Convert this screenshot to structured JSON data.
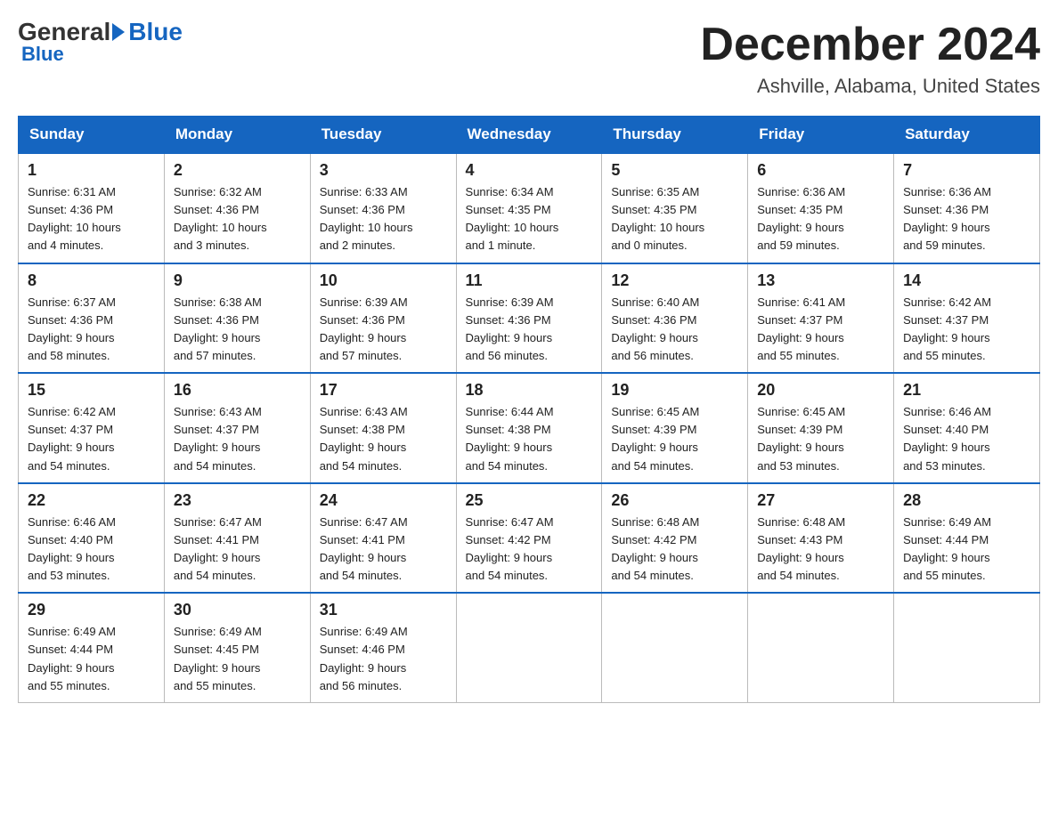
{
  "header": {
    "logo_general": "General",
    "logo_blue": "Blue",
    "month_title": "December 2024",
    "location": "Ashville, Alabama, United States"
  },
  "weekdays": [
    "Sunday",
    "Monday",
    "Tuesday",
    "Wednesday",
    "Thursday",
    "Friday",
    "Saturday"
  ],
  "weeks": [
    [
      {
        "day": "1",
        "sunrise": "Sunrise: 6:31 AM",
        "sunset": "Sunset: 4:36 PM",
        "daylight": "Daylight: 10 hours",
        "daylight2": "and 4 minutes."
      },
      {
        "day": "2",
        "sunrise": "Sunrise: 6:32 AM",
        "sunset": "Sunset: 4:36 PM",
        "daylight": "Daylight: 10 hours",
        "daylight2": "and 3 minutes."
      },
      {
        "day": "3",
        "sunrise": "Sunrise: 6:33 AM",
        "sunset": "Sunset: 4:36 PM",
        "daylight": "Daylight: 10 hours",
        "daylight2": "and 2 minutes."
      },
      {
        "day": "4",
        "sunrise": "Sunrise: 6:34 AM",
        "sunset": "Sunset: 4:35 PM",
        "daylight": "Daylight: 10 hours",
        "daylight2": "and 1 minute."
      },
      {
        "day": "5",
        "sunrise": "Sunrise: 6:35 AM",
        "sunset": "Sunset: 4:35 PM",
        "daylight": "Daylight: 10 hours",
        "daylight2": "and 0 minutes."
      },
      {
        "day": "6",
        "sunrise": "Sunrise: 6:36 AM",
        "sunset": "Sunset: 4:35 PM",
        "daylight": "Daylight: 9 hours",
        "daylight2": "and 59 minutes."
      },
      {
        "day": "7",
        "sunrise": "Sunrise: 6:36 AM",
        "sunset": "Sunset: 4:36 PM",
        "daylight": "Daylight: 9 hours",
        "daylight2": "and 59 minutes."
      }
    ],
    [
      {
        "day": "8",
        "sunrise": "Sunrise: 6:37 AM",
        "sunset": "Sunset: 4:36 PM",
        "daylight": "Daylight: 9 hours",
        "daylight2": "and 58 minutes."
      },
      {
        "day": "9",
        "sunrise": "Sunrise: 6:38 AM",
        "sunset": "Sunset: 4:36 PM",
        "daylight": "Daylight: 9 hours",
        "daylight2": "and 57 minutes."
      },
      {
        "day": "10",
        "sunrise": "Sunrise: 6:39 AM",
        "sunset": "Sunset: 4:36 PM",
        "daylight": "Daylight: 9 hours",
        "daylight2": "and 57 minutes."
      },
      {
        "day": "11",
        "sunrise": "Sunrise: 6:39 AM",
        "sunset": "Sunset: 4:36 PM",
        "daylight": "Daylight: 9 hours",
        "daylight2": "and 56 minutes."
      },
      {
        "day": "12",
        "sunrise": "Sunrise: 6:40 AM",
        "sunset": "Sunset: 4:36 PM",
        "daylight": "Daylight: 9 hours",
        "daylight2": "and 56 minutes."
      },
      {
        "day": "13",
        "sunrise": "Sunrise: 6:41 AM",
        "sunset": "Sunset: 4:37 PM",
        "daylight": "Daylight: 9 hours",
        "daylight2": "and 55 minutes."
      },
      {
        "day": "14",
        "sunrise": "Sunrise: 6:42 AM",
        "sunset": "Sunset: 4:37 PM",
        "daylight": "Daylight: 9 hours",
        "daylight2": "and 55 minutes."
      }
    ],
    [
      {
        "day": "15",
        "sunrise": "Sunrise: 6:42 AM",
        "sunset": "Sunset: 4:37 PM",
        "daylight": "Daylight: 9 hours",
        "daylight2": "and 54 minutes."
      },
      {
        "day": "16",
        "sunrise": "Sunrise: 6:43 AM",
        "sunset": "Sunset: 4:37 PM",
        "daylight": "Daylight: 9 hours",
        "daylight2": "and 54 minutes."
      },
      {
        "day": "17",
        "sunrise": "Sunrise: 6:43 AM",
        "sunset": "Sunset: 4:38 PM",
        "daylight": "Daylight: 9 hours",
        "daylight2": "and 54 minutes."
      },
      {
        "day": "18",
        "sunrise": "Sunrise: 6:44 AM",
        "sunset": "Sunset: 4:38 PM",
        "daylight": "Daylight: 9 hours",
        "daylight2": "and 54 minutes."
      },
      {
        "day": "19",
        "sunrise": "Sunrise: 6:45 AM",
        "sunset": "Sunset: 4:39 PM",
        "daylight": "Daylight: 9 hours",
        "daylight2": "and 54 minutes."
      },
      {
        "day": "20",
        "sunrise": "Sunrise: 6:45 AM",
        "sunset": "Sunset: 4:39 PM",
        "daylight": "Daylight: 9 hours",
        "daylight2": "and 53 minutes."
      },
      {
        "day": "21",
        "sunrise": "Sunrise: 6:46 AM",
        "sunset": "Sunset: 4:40 PM",
        "daylight": "Daylight: 9 hours",
        "daylight2": "and 53 minutes."
      }
    ],
    [
      {
        "day": "22",
        "sunrise": "Sunrise: 6:46 AM",
        "sunset": "Sunset: 4:40 PM",
        "daylight": "Daylight: 9 hours",
        "daylight2": "and 53 minutes."
      },
      {
        "day": "23",
        "sunrise": "Sunrise: 6:47 AM",
        "sunset": "Sunset: 4:41 PM",
        "daylight": "Daylight: 9 hours",
        "daylight2": "and 54 minutes."
      },
      {
        "day": "24",
        "sunrise": "Sunrise: 6:47 AM",
        "sunset": "Sunset: 4:41 PM",
        "daylight": "Daylight: 9 hours",
        "daylight2": "and 54 minutes."
      },
      {
        "day": "25",
        "sunrise": "Sunrise: 6:47 AM",
        "sunset": "Sunset: 4:42 PM",
        "daylight": "Daylight: 9 hours",
        "daylight2": "and 54 minutes."
      },
      {
        "day": "26",
        "sunrise": "Sunrise: 6:48 AM",
        "sunset": "Sunset: 4:42 PM",
        "daylight": "Daylight: 9 hours",
        "daylight2": "and 54 minutes."
      },
      {
        "day": "27",
        "sunrise": "Sunrise: 6:48 AM",
        "sunset": "Sunset: 4:43 PM",
        "daylight": "Daylight: 9 hours",
        "daylight2": "and 54 minutes."
      },
      {
        "day": "28",
        "sunrise": "Sunrise: 6:49 AM",
        "sunset": "Sunset: 4:44 PM",
        "daylight": "Daylight: 9 hours",
        "daylight2": "and 55 minutes."
      }
    ],
    [
      {
        "day": "29",
        "sunrise": "Sunrise: 6:49 AM",
        "sunset": "Sunset: 4:44 PM",
        "daylight": "Daylight: 9 hours",
        "daylight2": "and 55 minutes."
      },
      {
        "day": "30",
        "sunrise": "Sunrise: 6:49 AM",
        "sunset": "Sunset: 4:45 PM",
        "daylight": "Daylight: 9 hours",
        "daylight2": "and 55 minutes."
      },
      {
        "day": "31",
        "sunrise": "Sunrise: 6:49 AM",
        "sunset": "Sunset: 4:46 PM",
        "daylight": "Daylight: 9 hours",
        "daylight2": "and 56 minutes."
      },
      null,
      null,
      null,
      null
    ]
  ]
}
